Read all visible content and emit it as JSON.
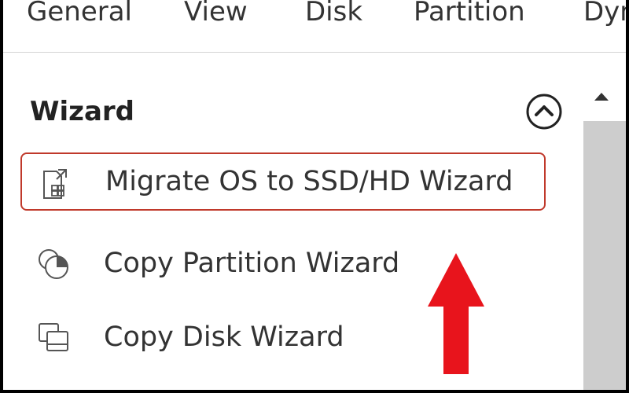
{
  "menu": {
    "items": [
      "General",
      "View",
      "Disk",
      "Partition",
      "Dynamic Disk"
    ]
  },
  "panel": {
    "section_title": "Wizard",
    "collapse_icon": "chevron-up-circle-icon",
    "items": [
      {
        "label": "Migrate OS to SSD/HD Wizard",
        "icon": "migrate-os-icon",
        "highlighted": true
      },
      {
        "label": "Copy Partition Wizard",
        "icon": "copy-partition-icon",
        "highlighted": false
      },
      {
        "label": "Copy Disk Wizard",
        "icon": "copy-disk-icon",
        "highlighted": false
      }
    ]
  },
  "annotation": {
    "arrow_color": "#e8141c",
    "highlight_color": "#c0392b"
  },
  "colors": {
    "text": "#333333",
    "scrollbar_track": "#cdcdcd",
    "frame": "#000000"
  }
}
